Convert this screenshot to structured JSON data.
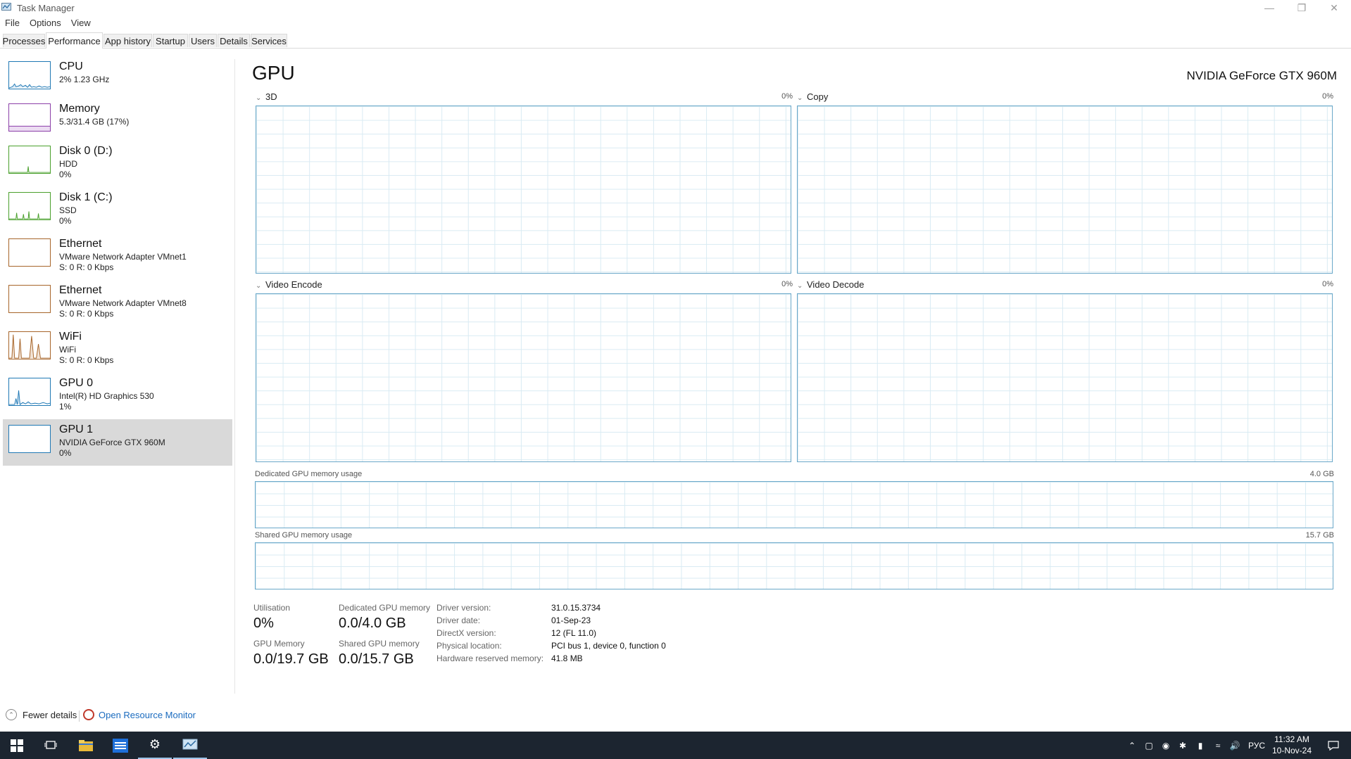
{
  "window": {
    "title": "Task Manager",
    "controls": [
      "minimize-icon",
      "restore-icon",
      "close-icon"
    ]
  },
  "menu": [
    "File",
    "Options",
    "View"
  ],
  "tabs": [
    "Processes",
    "Performance",
    "App history",
    "Startup",
    "Users",
    "Details",
    "Services"
  ],
  "active_tab": "Performance",
  "sidebar": {
    "items": [
      {
        "title": "CPU",
        "lines": [
          "2%  1.23 GHz"
        ],
        "color": "#1f78b4"
      },
      {
        "title": "Memory",
        "lines": [
          "5.3/31.4 GB (17%)"
        ],
        "color": "#8b3fa8"
      },
      {
        "title": "Disk 0 (D:)",
        "lines": [
          "HDD",
          "0%"
        ],
        "color": "#4aa02c"
      },
      {
        "title": "Disk 1 (C:)",
        "lines": [
          "SSD",
          "0%"
        ],
        "color": "#4aa02c"
      },
      {
        "title": "Ethernet",
        "lines": [
          "VMware Network Adapter VMnet1",
          "S: 0  R: 0 Kbps"
        ],
        "color": "#a7652a"
      },
      {
        "title": "Ethernet",
        "lines": [
          "VMware Network Adapter VMnet8",
          "S: 0  R: 0 Kbps"
        ],
        "color": "#a7652a"
      },
      {
        "title": "WiFi",
        "lines": [
          "WiFi",
          "S: 0  R: 0 Kbps"
        ],
        "color": "#a7652a"
      },
      {
        "title": "GPU 0",
        "lines": [
          "Intel(R) HD Graphics 530",
          "1%"
        ],
        "color": "#1f78b4"
      },
      {
        "title": "GPU 1",
        "lines": [
          "NVIDIA GeForce GTX 960M",
          "0%"
        ],
        "color": "#1f78b4"
      }
    ],
    "selected": "GPU 1"
  },
  "main": {
    "title": "GPU",
    "model": "NVIDIA GeForce GTX 960M",
    "engines": [
      {
        "label": "3D",
        "percent": "0%"
      },
      {
        "label": "Copy",
        "percent": "0%"
      },
      {
        "label": "Video Encode",
        "percent": "0%"
      },
      {
        "label": "Video Decode",
        "percent": "0%"
      }
    ],
    "dedicated_label": "Dedicated GPU memory usage",
    "dedicated_max": "4.0 GB",
    "shared_label": "Shared GPU memory usage",
    "shared_max": "15.7 GB",
    "accent_color": "#6aa8c9"
  },
  "stats": {
    "utilisation_label": "Utilisation",
    "utilisation_value": "0%",
    "dedicated_label": "Dedicated GPU memory",
    "dedicated_value": "0.0/4.0 GB",
    "gpu_memory_label": "GPU Memory",
    "gpu_memory_value": "0.0/19.7 GB",
    "shared_label": "Shared GPU memory",
    "shared_value": "0.0/15.7 GB"
  },
  "info": [
    {
      "label": "Driver version:",
      "value": "31.0.15.3734"
    },
    {
      "label": "Driver date:",
      "value": "01-Sep-23"
    },
    {
      "label": "DirectX version:",
      "value": "12 (FL 11.0)"
    },
    {
      "label": "Physical location:",
      "value": "PCI bus 1, device 0, function 0"
    },
    {
      "label": "Hardware reserved memory:",
      "value": "41.8 MB"
    }
  ],
  "footer": {
    "fewer_details": "Fewer details",
    "open_resource_monitor": "Open Resource Monitor"
  },
  "taskbar": {
    "language": "РУС",
    "time": "11:32 AM",
    "date": "10-Nov-24"
  }
}
